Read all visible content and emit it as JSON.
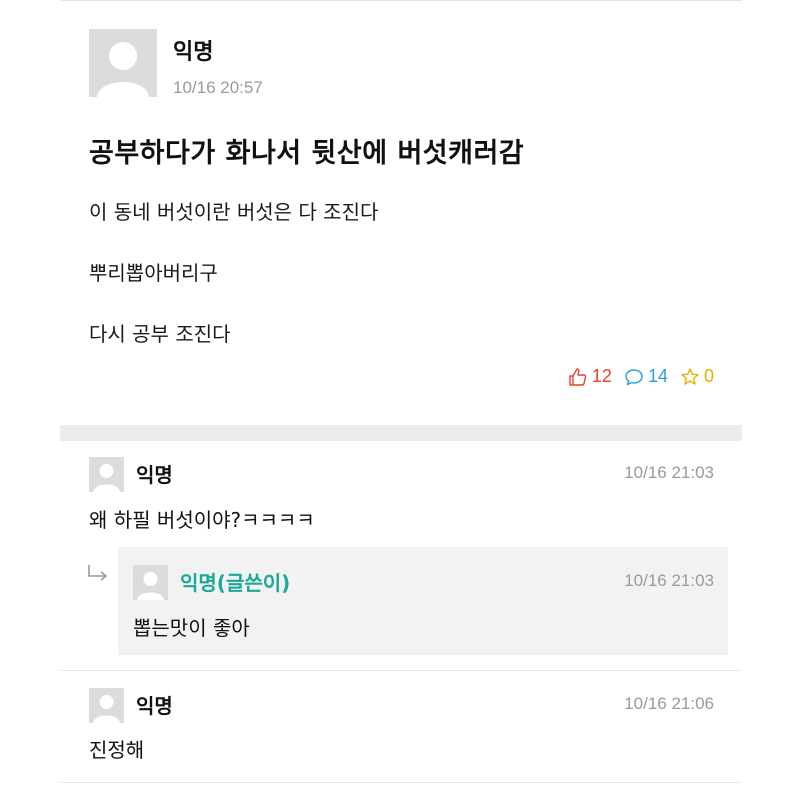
{
  "post": {
    "author": "익명",
    "time": "10/16 20:57",
    "title": "공부하다가 화나서 뒷산에 버섯캐러감",
    "body": [
      "이 동네 버섯이란 버섯은 다 조진다",
      "뿌리뽑아버리구",
      "다시 공부 조진다"
    ],
    "stats": {
      "likes": "12",
      "comments": "14",
      "scraps": "0"
    }
  },
  "comments": [
    {
      "author": "익명",
      "time": "10/16 21:03",
      "text": "왜 하필 버섯이야?ㅋㅋㅋㅋ"
    },
    {
      "author": "익명(글쓴이)",
      "time": "10/16 21:03",
      "text": "뽑는맛이 좋아",
      "is_reply": true
    },
    {
      "author": "익명",
      "time": "10/16 21:06",
      "text": "진정해"
    }
  ],
  "colors": {
    "like": "#e3432f",
    "comment": "#2a9fd8",
    "scrap": "#e6b000",
    "op_name": "#19a997"
  },
  "icons": {
    "like": "thumbs-up-icon",
    "comment": "speech-bubble-icon",
    "scrap": "star-icon",
    "reply": "reply-arrow-icon",
    "avatar": "default-avatar-icon"
  }
}
